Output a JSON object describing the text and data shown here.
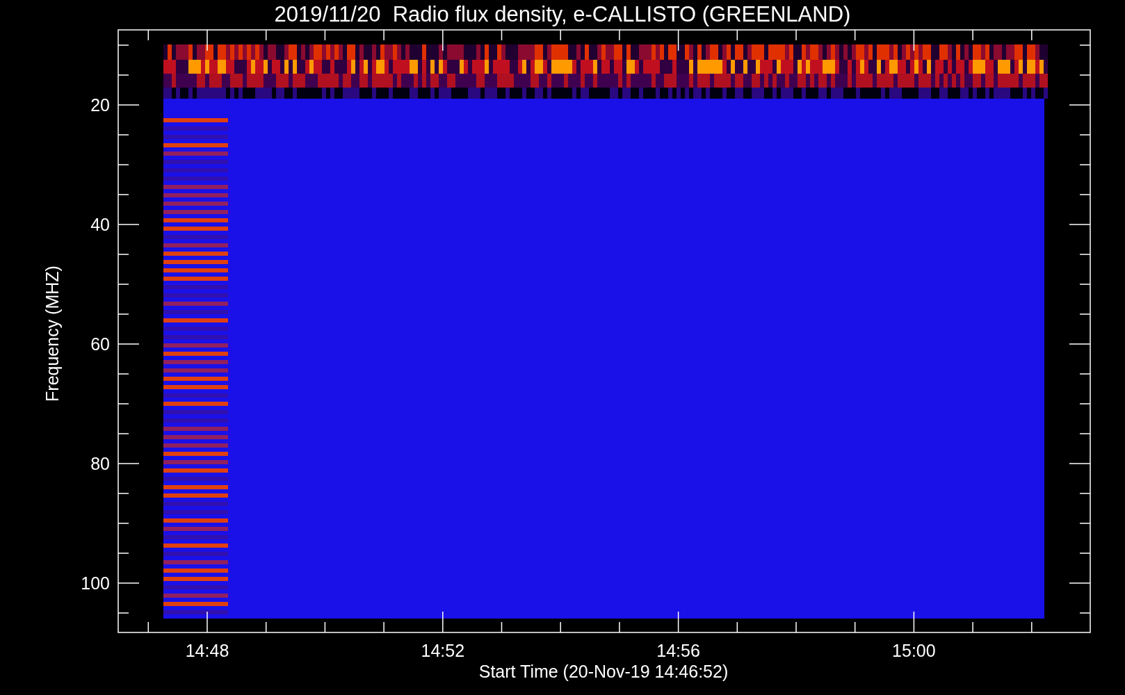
{
  "title": "2019/11/20  Radio flux density, e-CALLISTO (GREENLAND)",
  "plot": {
    "xlabel": "Start Time (20-Nov-19 14:46:52)",
    "ylabel": "Frequency (MHZ)",
    "xticks": [
      "14:48",
      "14:52",
      "14:56",
      "15:00"
    ],
    "yticks": [
      "20",
      "40",
      "60",
      "80",
      "100"
    ]
  }
}
